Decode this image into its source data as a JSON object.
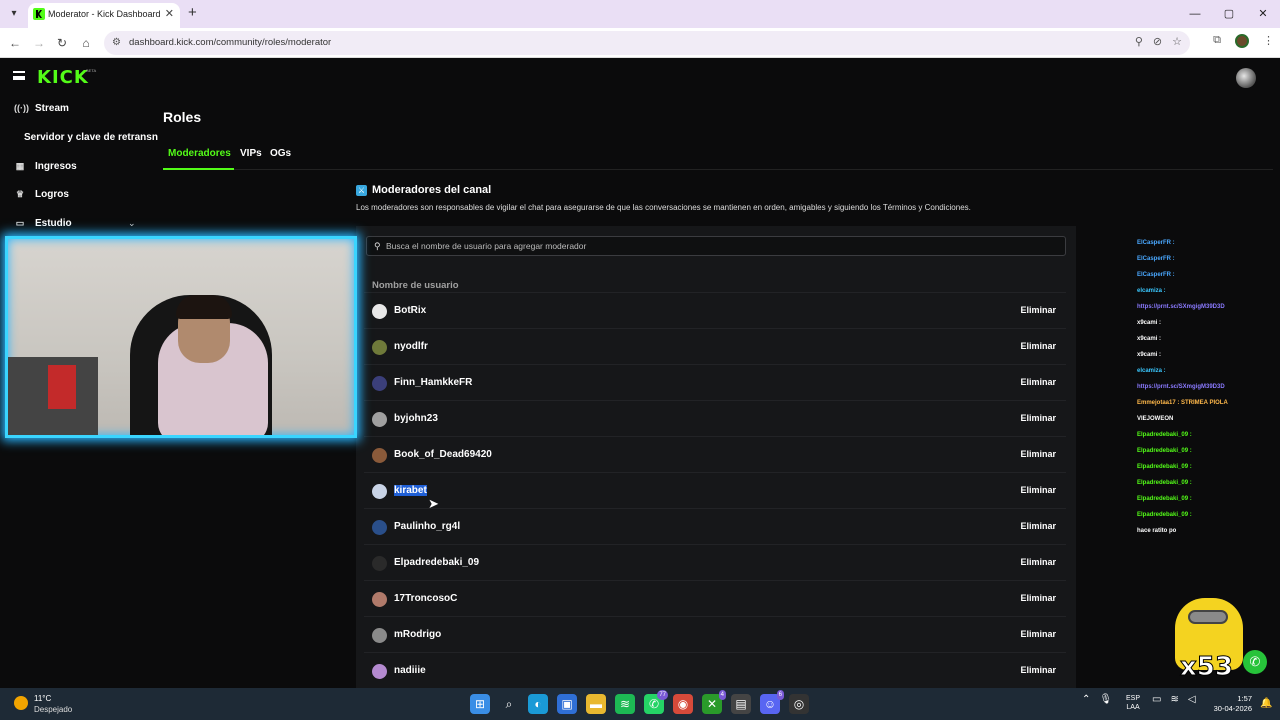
{
  "browser": {
    "tab_title": "Moderator - Kick Dashboard",
    "url": "dashboard.kick.com/community/roles/moderator",
    "new_tab_glyph": "+",
    "close_glyph": "✕",
    "window_controls": [
      "—",
      "▢",
      "✕"
    ]
  },
  "app": {
    "logo": "KICK",
    "logo_badge": "BETA"
  },
  "sidebar": {
    "items": [
      {
        "label": "Stream",
        "icon": "broadcast-icon"
      },
      {
        "label": "Servidor y clave de retransn",
        "icon": ""
      },
      {
        "label": "Ingresos",
        "icon": "chart-icon"
      },
      {
        "label": "Logros",
        "icon": "trophy-icon"
      },
      {
        "label": "Estudio",
        "icon": "studio-icon"
      }
    ]
  },
  "page": {
    "title": "Roles",
    "tabs": [
      {
        "label": "Moderadores",
        "active": true
      },
      {
        "label": "VIPs",
        "active": false
      },
      {
        "label": "OGs",
        "active": false
      }
    ],
    "section_title": "Moderadores del canal",
    "section_desc": "Los moderadores son responsables de vigilar el chat para asegurarse de que las conversaciones se mantienen en orden, amigables y siguiendo los Términos y Condiciones.",
    "search_placeholder": "Busca el nombre de usuario para agregar moderador",
    "column_header": "Nombre de usuario",
    "remove_label": "Eliminar",
    "moderators": [
      {
        "name": "BotRix",
        "avatar_color": "#e8e8e8"
      },
      {
        "name": "nyodlfr",
        "avatar_color": "#6f7a3a"
      },
      {
        "name": "Finn_HamkkeFR",
        "avatar_color": "#3b3f7a"
      },
      {
        "name": "byjohn23",
        "avatar_color": "#a0a0a0"
      },
      {
        "name": "Book_of_Dead69420",
        "avatar_color": "#8a5a3a"
      },
      {
        "name": "kirabet",
        "avatar_color": "#c9d4e6",
        "selected": true
      },
      {
        "name": "Paulinho_rg4l",
        "avatar_color": "#2a4f8a"
      },
      {
        "name": "Elpadredebaki_09",
        "avatar_color": "#2a2a2a"
      },
      {
        "name": "17TroncosoC",
        "avatar_color": "#b07a6a"
      },
      {
        "name": "mRodrigo",
        "avatar_color": "#8a8a8a"
      },
      {
        "name": "nadiiie",
        "avatar_color": "#b48ad0"
      }
    ]
  },
  "chat": {
    "lines": [
      {
        "text": "ElCasperFR :",
        "color": "#4aa8ff"
      },
      {
        "text": "ElCasperFR :",
        "color": "#4aa8ff"
      },
      {
        "text": "ElCasperFR :",
        "color": "#4aa8ff"
      },
      {
        "text": "elcamiza :",
        "color": "#3ac8ff"
      },
      {
        "text": "https://prnt.sc/SXmgigM39D3D",
        "color": "#8a7aff"
      },
      {
        "text": "x9cami :",
        "color": "#ffffff"
      },
      {
        "text": "x9cami :",
        "color": "#ffffff"
      },
      {
        "text": "x9cami :",
        "color": "#ffffff"
      },
      {
        "text": "elcamiza :",
        "color": "#3ac8ff"
      },
      {
        "text": "https://prnt.sc/SXmgigM39D3D",
        "color": "#8a7aff"
      },
      {
        "text": "Emmejotaa17 : STRIMEA PIOLA",
        "color": "#ffb84a"
      },
      {
        "text": "VIEJOWEON",
        "color": "#ffffff"
      },
      {
        "text": "Elpadredebaki_09 :",
        "color": "#53fc18"
      },
      {
        "text": "Elpadredebaki_09 :",
        "color": "#53fc18"
      },
      {
        "text": "Elpadredebaki_09 :",
        "color": "#53fc18"
      },
      {
        "text": "Elpadredebaki_09 :",
        "color": "#53fc18"
      },
      {
        "text": "Elpadredebaki_09 :",
        "color": "#53fc18"
      },
      {
        "text": "Elpadredebaki_09 :",
        "color": "#53fc18"
      },
      {
        "text": "hace ratito po",
        "color": "#ffffff"
      }
    ],
    "multiplier": "x53"
  },
  "taskbar": {
    "temp": "11°C",
    "weather": "Despejado",
    "apps": [
      {
        "name": "start-icon",
        "glyph": "⊞",
        "color": "#3a8ee6"
      },
      {
        "name": "search-icon",
        "glyph": "⌕",
        "color": "transparent"
      },
      {
        "name": "edge-icon",
        "glyph": "◐",
        "color": "#1a9ad6"
      },
      {
        "name": "store-icon",
        "glyph": "▣",
        "color": "#2f6fd6"
      },
      {
        "name": "files-icon",
        "glyph": "▬",
        "color": "#e8b830"
      },
      {
        "name": "spotify-icon",
        "glyph": "≋",
        "color": "#1db954"
      },
      {
        "name": "whatsapp-icon",
        "glyph": "✆",
        "color": "#25d366",
        "badge": "77"
      },
      {
        "name": "chrome-icon",
        "glyph": "◉",
        "color": "#d64a3a"
      },
      {
        "name": "xbox-icon",
        "glyph": "✕",
        "color": "#2a9a2a",
        "badge": "4"
      },
      {
        "name": "capture-icon",
        "glyph": "▤",
        "color": "#444"
      },
      {
        "name": "discord-icon",
        "glyph": "☺",
        "color": "#5865f2",
        "badge": "6"
      },
      {
        "name": "obs-icon",
        "glyph": "◎",
        "color": "#333"
      }
    ],
    "lang_top": "ESP",
    "lang_bottom": "LAA",
    "time": "1:57",
    "date": "30-04-2026"
  }
}
